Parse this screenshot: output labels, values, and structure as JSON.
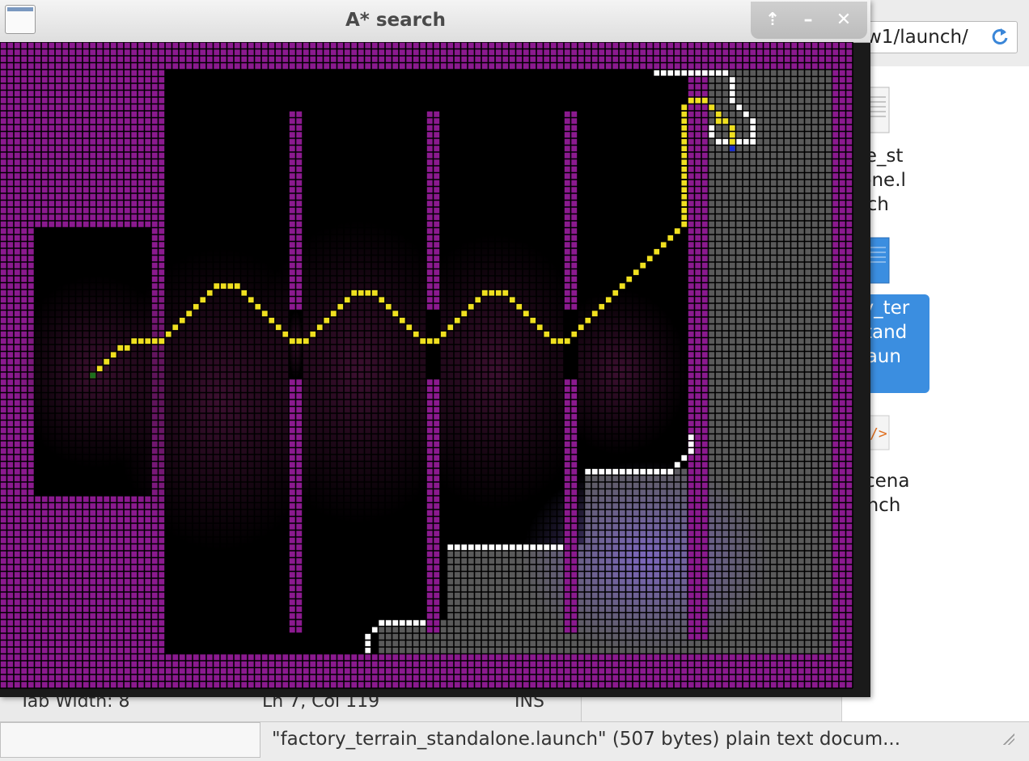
{
  "astar_window": {
    "title": "A* search",
    "controls": {
      "maximize": "⇡",
      "minimize": "–",
      "close": "✕"
    }
  },
  "file_manager": {
    "location_text": "w1/launch/",
    "files": [
      {
        "label": "ile_st\nlone.l\nnch",
        "icon": "text-file-icon"
      },
      {
        "label": "ry_ter\nstand\n.laun\nh",
        "icon": "text-file-icon",
        "selected": true
      },
      {
        "label": "scena\nunch",
        "icon": "xml-file-icon"
      }
    ],
    "statusbar_message": "\"factory_terrain_standalone.launch\" (507 bytes) plain text docum..."
  },
  "editor_statusbar": {
    "tab_width": "Tab Width: 8",
    "position": "Ln 7, Col 119",
    "mode": "INS"
  },
  "grid": {
    "colors": {
      "wall": "#8b1a8f",
      "open": "#000000",
      "explored": "#3c1030",
      "unvisited": "#5a5a5a",
      "frontier": "#ffffff",
      "path": "#f0e020",
      "start": "#1e6e1e",
      "goal": "#1a2ed0",
      "visited_light": "#8068c8"
    }
  }
}
